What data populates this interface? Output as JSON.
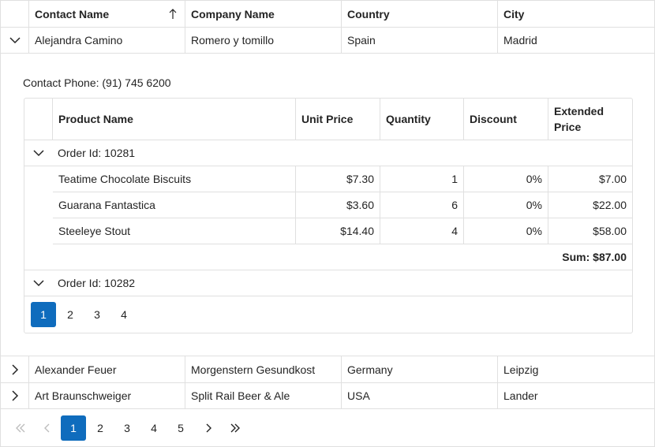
{
  "columns": {
    "contact_name": "Contact Name",
    "company_name": "Company Name",
    "country": "Country",
    "city": "City"
  },
  "rows": [
    {
      "contact": "Alejandra Camino",
      "company": "Romero y tomillo",
      "country": "Spain",
      "city": "Madrid"
    },
    {
      "contact": "Alexander Feuer",
      "company": "Morgenstern Gesundkost",
      "country": "Germany",
      "city": "Leipzig"
    },
    {
      "contact": "Art Braunschweiger",
      "company": "Split Rail Beer & Ale",
      "country": "USA",
      "city": "Lander"
    }
  ],
  "detail": {
    "phone_text": "Contact Phone: (91) 745 6200",
    "columns": {
      "product_name": "Product Name",
      "unit_price": "Unit Price",
      "quantity": "Quantity",
      "discount": "Discount",
      "extended_price": "Extended Price"
    },
    "groups": [
      {
        "label": "Order Id: 10281",
        "items": [
          {
            "product": "Teatime Chocolate Biscuits",
            "unit_price": "$7.30",
            "quantity": "1",
            "discount": "0%",
            "extended": "$7.00"
          },
          {
            "product": "Guarana Fantastica",
            "unit_price": "$3.60",
            "quantity": "6",
            "discount": "0%",
            "extended": "$22.00"
          },
          {
            "product": "Steeleye Stout",
            "unit_price": "$14.40",
            "quantity": "4",
            "discount": "0%",
            "extended": "$58.00"
          }
        ],
        "sum": "Sum: $87.00"
      },
      {
        "label": "Order Id: 10282"
      }
    ],
    "pager": [
      "1",
      "2",
      "3",
      "4"
    ]
  },
  "pager": [
    "1",
    "2",
    "3",
    "4",
    "5"
  ],
  "accent": "#0f6cbd"
}
